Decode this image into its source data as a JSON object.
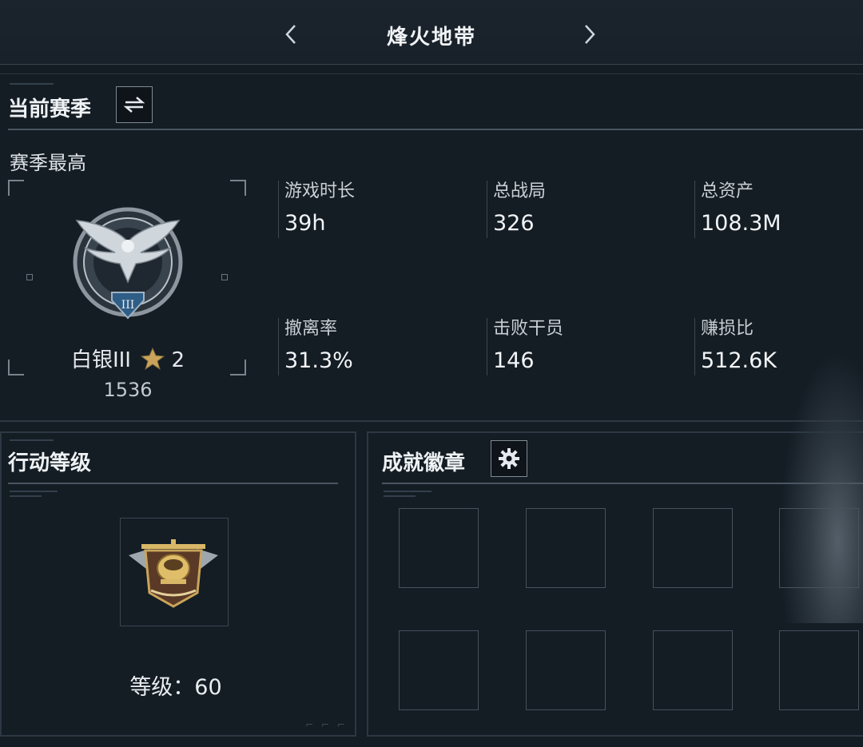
{
  "header": {
    "title": "烽火地带",
    "prev_icon": "chevron-left-icon",
    "next_icon": "chevron-right-icon"
  },
  "current_season": {
    "title": "当前赛季",
    "switch_icon": "swap-icon",
    "subtitle": "赛季最高",
    "rank": {
      "name": "白银III",
      "stars": "2",
      "score": "1536",
      "badge_icon": "eagle-rank-badge-icon",
      "star_icon": "star-icon"
    },
    "stats": [
      {
        "label": "游戏时长",
        "value": "39h"
      },
      {
        "label": "总战局",
        "value": "326"
      },
      {
        "label": "总资产",
        "value": "108.3M"
      },
      {
        "label": "撤离率",
        "value": "31.3%"
      },
      {
        "label": "击败干员",
        "value": "146"
      },
      {
        "label": "赚损比",
        "value": "512.6K"
      }
    ]
  },
  "action_level": {
    "title": "行动等级",
    "emblem_icon": "helicopter-emblem-icon",
    "level_text": "等级：60"
  },
  "achievements": {
    "title": "成就徽章",
    "settings_icon": "gear-icon",
    "slots": 8
  },
  "colors": {
    "background": "#141c24",
    "gold": "#c9a45a",
    "silver": "#b8c0c8"
  }
}
